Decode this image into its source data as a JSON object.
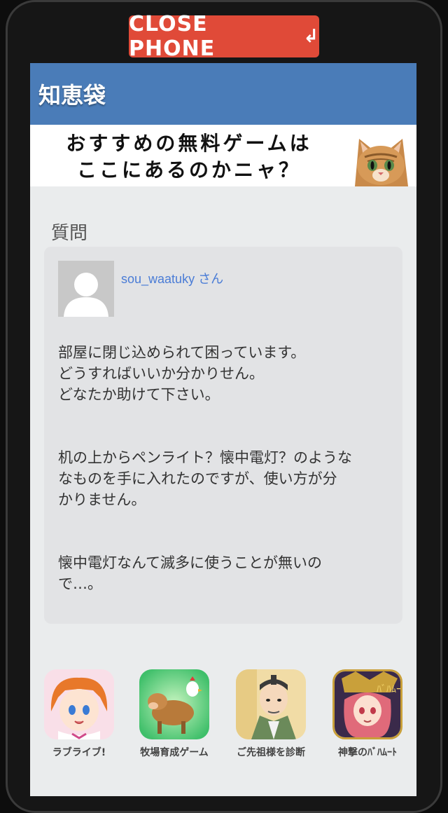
{
  "close_button": {
    "label": "CLOSE PHONE",
    "icon": "return-arrow-icon"
  },
  "header": {
    "title": "知恵袋"
  },
  "banner": {
    "line1": "おすすめの無料ゲームは",
    "line2": "ここにあるのかニャ？"
  },
  "question": {
    "section_title": "質問",
    "user": "sou_waatuky さん",
    "paragraphs": [
      [
        "部屋に閉じ込められて困っています。",
        "どうすればいいか分かりせん。",
        "どなたか助けて下さい。"
      ],
      [
        "机の上からペンライト？懐中電灯？のような",
        "なものを手に入れたのですが、使い方が分",
        "かりません。"
      ],
      [
        "懐中電灯なんて滅多に使うことが無いの",
        "で…。"
      ]
    ]
  },
  "apps": [
    {
      "label": "ラブライブ!",
      "icon": "love-live-icon"
    },
    {
      "label": "牧場育成ゲーム",
      "icon": "ranch-game-icon"
    },
    {
      "label": "ご先祖様を診断",
      "icon": "ancestor-icon"
    },
    {
      "label": "神撃のﾊﾞﾊﾑｰﾄ",
      "icon": "bahamut-icon"
    }
  ],
  "colors": {
    "header_bg": "#4a7cb8",
    "close_button_bg": "#e04a38",
    "username": "#4a7cd6",
    "screen_bg": "#eaeced"
  }
}
